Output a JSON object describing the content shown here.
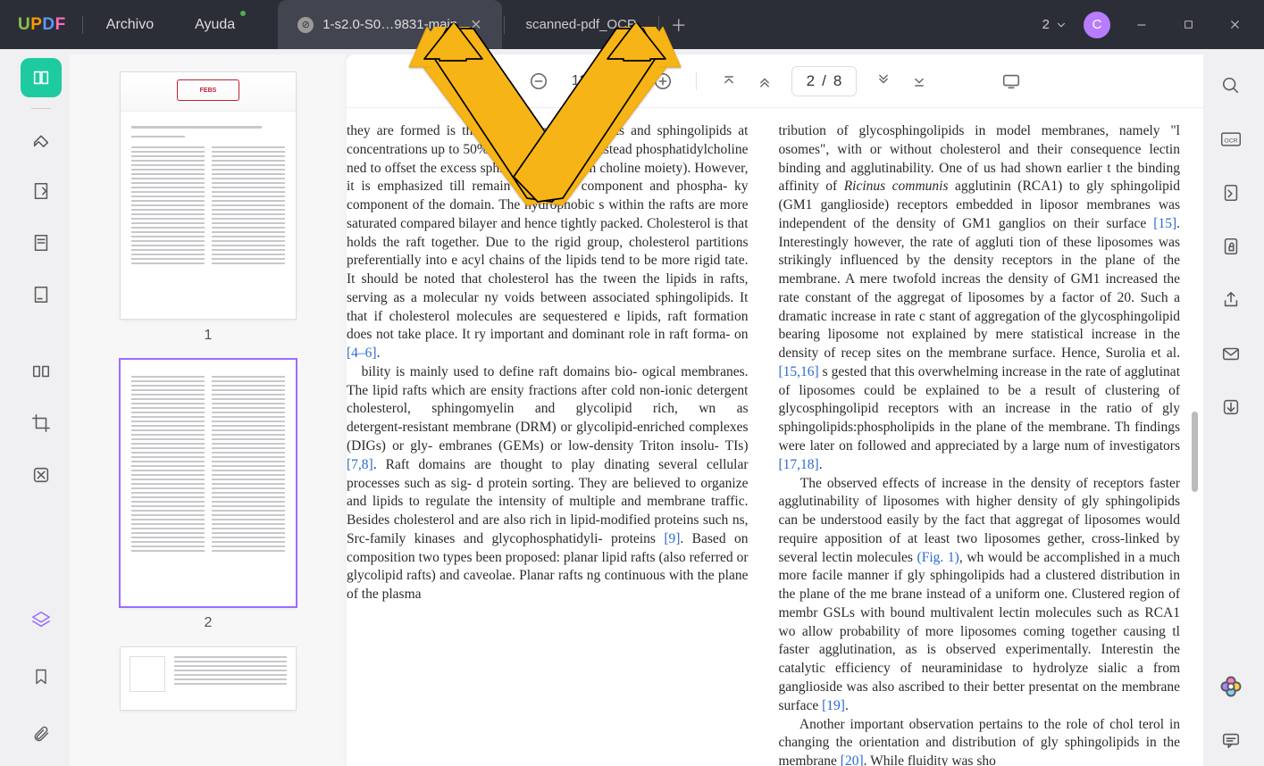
{
  "logo": "UPDF",
  "menu": {
    "file": "Archivo",
    "help": "Ayuda"
  },
  "tabs": [
    {
      "label": "1-s2.0-S0…9831-main",
      "active": true
    },
    {
      "label": "scanned-pdf_OCR",
      "active": false
    }
  ],
  "counter": "2",
  "avatar_initial": "C",
  "toolbar": {
    "zoom": "125%",
    "page_current": "2",
    "page_sep": "/",
    "page_total": "8"
  },
  "thumbs": [
    "1",
    "2"
  ],
  "refs": {
    "r46": "[4–6]",
    "r78": "[7,8]",
    "r9": "[9]",
    "r15": "[15]",
    "r1516": "[15,16]",
    "r1718": "[17,18]",
    "rfig1": "(Fig. 1)",
    "r19": "[19]",
    "r20": "[20]"
  },
  "doc": {
    "p1a": "they are formed is the lipid composition. Rafts  and sphingolipids at concentrations up to 50% f the membranes. Instead phosphatidylcholine ned to offset the excess sphingolipid levels n choline moiety). However, it is emphasized till remain the minor component and phospha- ky component of the domain. The hydrophobic s within the rafts are more saturated compared bilayer and hence tightly packed. Cholesterol is  that holds the raft together. Due to the rigid group, cholesterol partitions preferentially into e acyl chains of the lipids tend to be more rigid tate. It should be noted that cholesterol has the tween the lipids in rafts, serving as a molecular ny voids between associated sphingolipids. It  that if cholesterol molecules are sequestered e lipids, raft formation does not take place. It ry important and dominant role in raft forma- on ",
    "p1b": "bility is mainly used to define raft domains bio- ogical membranes. The lipid rafts which are ensity fractions after cold non-ionic detergent cholesterol, sphingomyelin and glycolipid rich, wn as detergent‑resistant membrane (DRM) or  glycolipid‑enriched complexes (DIGs) or gly- embranes (GEMs) or low‑density Triton insolu- TIs) ",
    "p1c": ". Raft domains are thought to play dinating several cellular processes such as sig- d protein sorting. They are believed to organize  and lipids to regulate the intensity of multiple and membrane traffic. Besides cholesterol and  are also rich in lipid‑modified proteins such ns, Src‑family kinases and glycophosphatidyli-  proteins ",
    "p1d": ". Based on composition two types been proposed: planar lipid rafts (also referred  or glycolipid rafts) and caveolae. Planar rafts ng continuous with the plane of the plasma",
    "p2a": "tribution of glycosphingolipids in model membranes, namely \"l osomes\", with or without cholesterol and their consequence lectin binding and agglutinability. One of us had shown earlier t the binding affinity of ",
    "p2ric": "Ricinus communis",
    "p2a2": " agglutinin (RCA1) to gly sphingolipid (GM1 ganglioside) receptors embedded in liposor membranes was independent of the density of GM1 ganglios on their surface ",
    "p2a3": ". Interestingly however, the rate of aggluti tion of these liposomes was strikingly influenced by the density receptors in the plane of the membrane. A mere twofold increas the density of GM1 increased the rate constant of the aggregat of liposomes by a factor of 20. Such a dramatic increase in rate c stant of aggregation of the glycosphingolipid bearing liposome not explained by mere statistical increase in the density of recep sites on the membrane surface. Hence, Surolia et al. ",
    "p2a4": " s gested that this overwhelming increase in the rate of agglutinat of liposomes could be explained to be a result of clustering of  glycosphingolipid receptors with an increase in the ratio of gly sphingolipids:phospholipids in the plane of the membrane. Th findings were later on followed and appreciated by a large num of investigators ",
    "p2b": "The observed effects of increase in the density of receptors faster agglutinability of liposomes with higher density of gly sphingolipids can be understood easily by the fact that aggregat of liposomes would require apposition of at least two liposomes gether, cross‑linked by several lectin molecules ",
    "p2b2": ", wh would be accomplished in a much more facile manner if gly sphingolipids had a clustered distribution in the plane of the me brane instead of a uniform one. Clustered region of membr GSLs with bound multivalent lectin molecules such as RCA1 wo allow probability of more liposomes coming together causing tl faster agglutination, as is observed experimentally. Interestin the catalytic efficiency of neuraminidase to hydrolyze sialic a from ganglioside was also ascribed to their better presentat on the membrane surface ",
    "p2c": "Another important observation pertains to the role of chol terol in changing the orientation and distribution of gly sphingolipids in the membrane ",
    "p2c2": ". While fluidity was sho"
  }
}
